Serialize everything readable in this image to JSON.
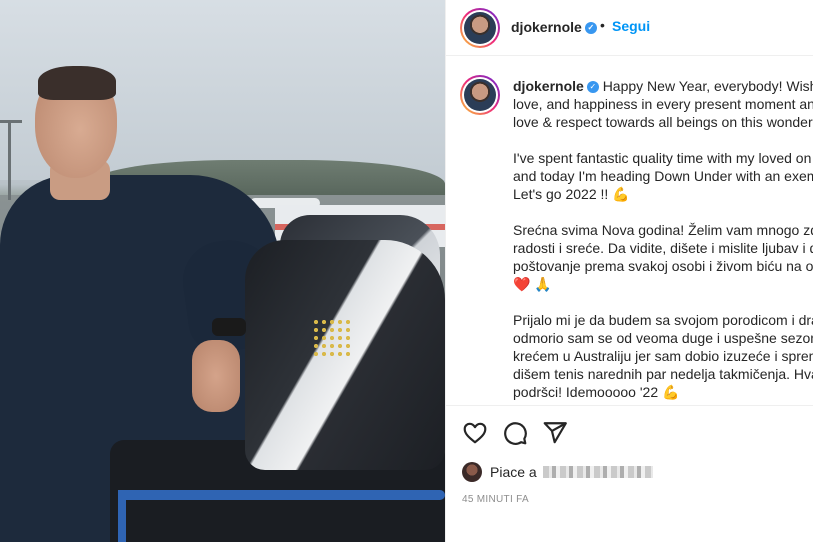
{
  "post": {
    "username": "djokernole",
    "follow_label": "Segui",
    "separator": "•",
    "verified_glyph": "✓"
  },
  "caption": {
    "username": "djokernole",
    "verified_glyph": "✓",
    "paragraphs": [
      [
        "Happy New Year, everybody! Wishi",
        "love, and happiness in every present moment and",
        "love & respect towards all beings on this wonder"
      ],
      [
        "I've spent fantastic quality time with my loved on",
        "and today I'm heading Down Under with an exem",
        "Let's go 2022 !! 💪"
      ],
      [
        "Srećna svima Nova godina! Želim vam mnogo zd",
        "radosti i sreće. Da vidite, dišete i mislite ljubav i d",
        "poštovanje prema svakoj osobi i živom biću na ov",
        "❤️ 🙏"
      ],
      [
        "Prijalo mi je da budem sa svojom porodicom i dra",
        "odmorio sam se od veoma duge i uspešne sezon",
        "krećem u Australiju jer sam dobio izuzeće i sprem",
        "dišem tenis narednih par nedelja takmičenja. Hva",
        "podršci! Idemooooo '22 💪"
      ]
    ]
  },
  "likes": {
    "prefix": "Piace a"
  },
  "timestamp": "45 MINUTI FA",
  "icons": {
    "like": "heart-icon",
    "comment": "comment-icon",
    "share": "share-icon"
  },
  "colors": {
    "accent": "#0095f6",
    "verified": "#3897f0",
    "text": "#262626",
    "muted": "#8e8e8e"
  }
}
